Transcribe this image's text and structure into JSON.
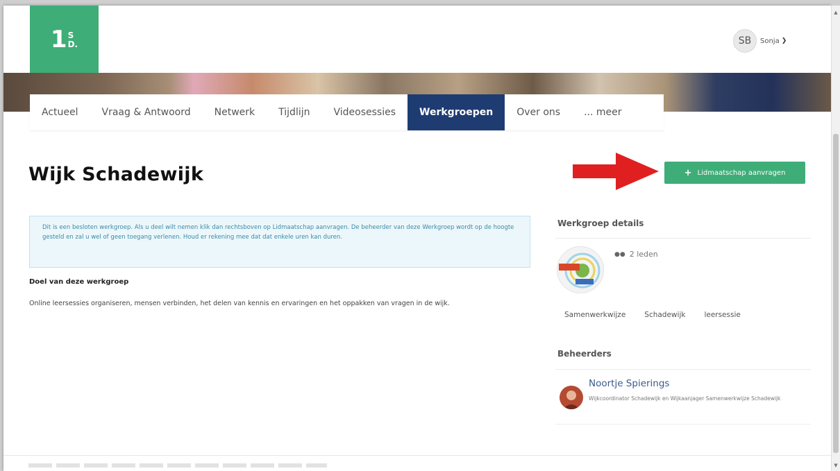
{
  "brand": {
    "logo_mark": "1",
    "logo_s": "S",
    "logo_d": "D.",
    "color": "#3fad77"
  },
  "user": {
    "initials": "SB",
    "name": "Sonja",
    "caret_icon": "chevron-down-icon"
  },
  "tabs": [
    {
      "label": "Actueel"
    },
    {
      "label": "Vraag & Antwoord"
    },
    {
      "label": "Netwerk"
    },
    {
      "label": "Tijdlijn"
    },
    {
      "label": "Videosessies"
    },
    {
      "label": "Werkgroepen",
      "active": true
    },
    {
      "label": "Over ons"
    },
    {
      "label": "... meer"
    }
  ],
  "page": {
    "title": "Wijk Schadewijk",
    "join_button": "Lidmaatschap aanvragen",
    "notice": "Dit is een besloten werkgroep. Als u deel wilt nemen klik dan rechtsboven op Lidmaatschap aanvragen. De beheerder van deze Werkgroep wordt op de hoogte gesteld en zal u wel of geen toegang verlenen. Houd er rekening mee dat dat enkele uren kan duren.",
    "goal_heading": "Doel van deze werkgroep",
    "goal_text": "Online leersessies organiseren, mensen verbinden, het delen van kennis en ervaringen en het oppakken van vragen in de wijk."
  },
  "sidebar": {
    "details_heading": "Werkgroep details",
    "members": "2 leden",
    "tags": [
      "Samenwerkwijze",
      "Schadewijk",
      "leersessie"
    ],
    "admins_heading": "Beheerders",
    "admin": {
      "name": "Noortje Spierings",
      "role": "Wijkcoordinator Schadewijk en Wijkaanjager Samenwerkwijze Schadewijk"
    }
  },
  "colors": {
    "accent": "#3fad77",
    "nav_active": "#1e3c72",
    "notice_bg": "#ecf7fb",
    "arrow": "#e02020"
  }
}
